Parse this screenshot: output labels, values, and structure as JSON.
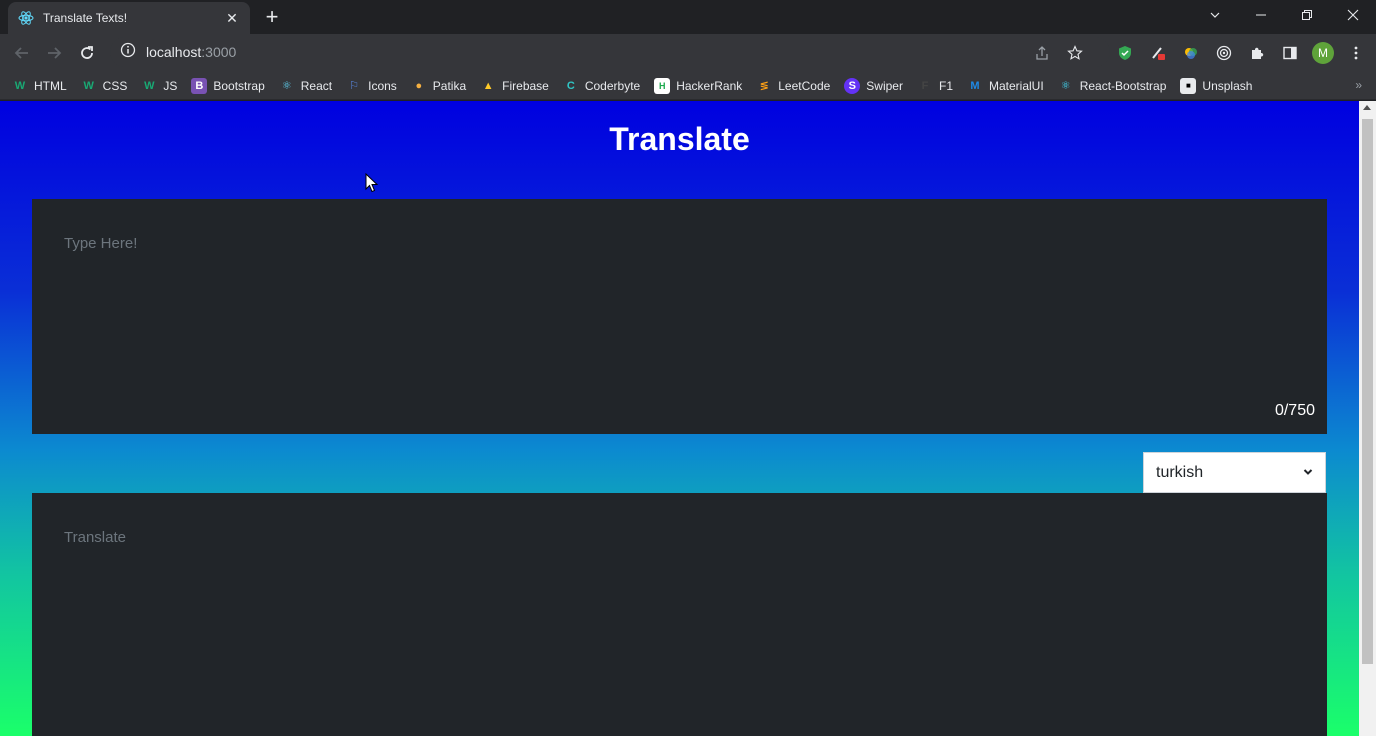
{
  "browser": {
    "tab_title": "Translate Texts!",
    "tab_close": "✕",
    "new_tab": "+",
    "url_host": "localhost",
    "url_port": ":3000",
    "profile_initial": "M"
  },
  "bookmarks": [
    {
      "label": "HTML",
      "icon": "w-icon",
      "glyph": "W",
      "color": "#19a974"
    },
    {
      "label": "CSS",
      "icon": "w-icon",
      "glyph": "W",
      "color": "#19a974"
    },
    {
      "label": "JS",
      "icon": "w-icon",
      "glyph": "W",
      "color": "#19a974"
    },
    {
      "label": "Bootstrap",
      "icon": "bootstrap-icon",
      "glyph": "B",
      "color": "#7952b3"
    },
    {
      "label": "React",
      "icon": "react-icon",
      "glyph": "⚛",
      "color": "#61dafb"
    },
    {
      "label": "Icons",
      "icon": "flag-icon",
      "glyph": "⚐",
      "color": "#5b8def"
    },
    {
      "label": "Patika",
      "icon": "patika-icon",
      "glyph": "●",
      "color": "#f5b041"
    },
    {
      "label": "Firebase",
      "icon": "firebase-icon",
      "glyph": "▲",
      "color": "#ffca28"
    },
    {
      "label": "Coderbyte",
      "icon": "coderbyte-icon",
      "glyph": "C",
      "color": "#2fc6c6"
    },
    {
      "label": "HackerRank",
      "icon": "hackerrank-icon",
      "glyph": "H",
      "color": "#1ba94c"
    },
    {
      "label": "LeetCode",
      "icon": "leetcode-icon",
      "glyph": "≶",
      "color": "#ffa116"
    },
    {
      "label": "Swiper",
      "icon": "swiper-icon",
      "glyph": "S",
      "color": "#6332f6"
    },
    {
      "label": "F1",
      "icon": "f1-icon",
      "glyph": "F",
      "color": "#444444"
    },
    {
      "label": "MaterialUI",
      "icon": "mui-icon",
      "glyph": "M",
      "color": "#1e88e5"
    },
    {
      "label": "React-Bootstrap",
      "icon": "react-bootstrap-icon",
      "glyph": "⚛",
      "color": "#41e0fd"
    },
    {
      "label": "Unsplash",
      "icon": "unsplash-icon",
      "glyph": "■",
      "color": "#111111"
    }
  ],
  "bookmarks_more": "»",
  "page": {
    "title": "Translate",
    "source_placeholder": "Type Here!",
    "char_count": "0/750",
    "target_placeholder": "Translate",
    "language_selected": "turkish"
  },
  "colors": {
    "gradient_top": "#0000e0",
    "gradient_bottom": "#1aff6a",
    "panel": "#212529"
  }
}
